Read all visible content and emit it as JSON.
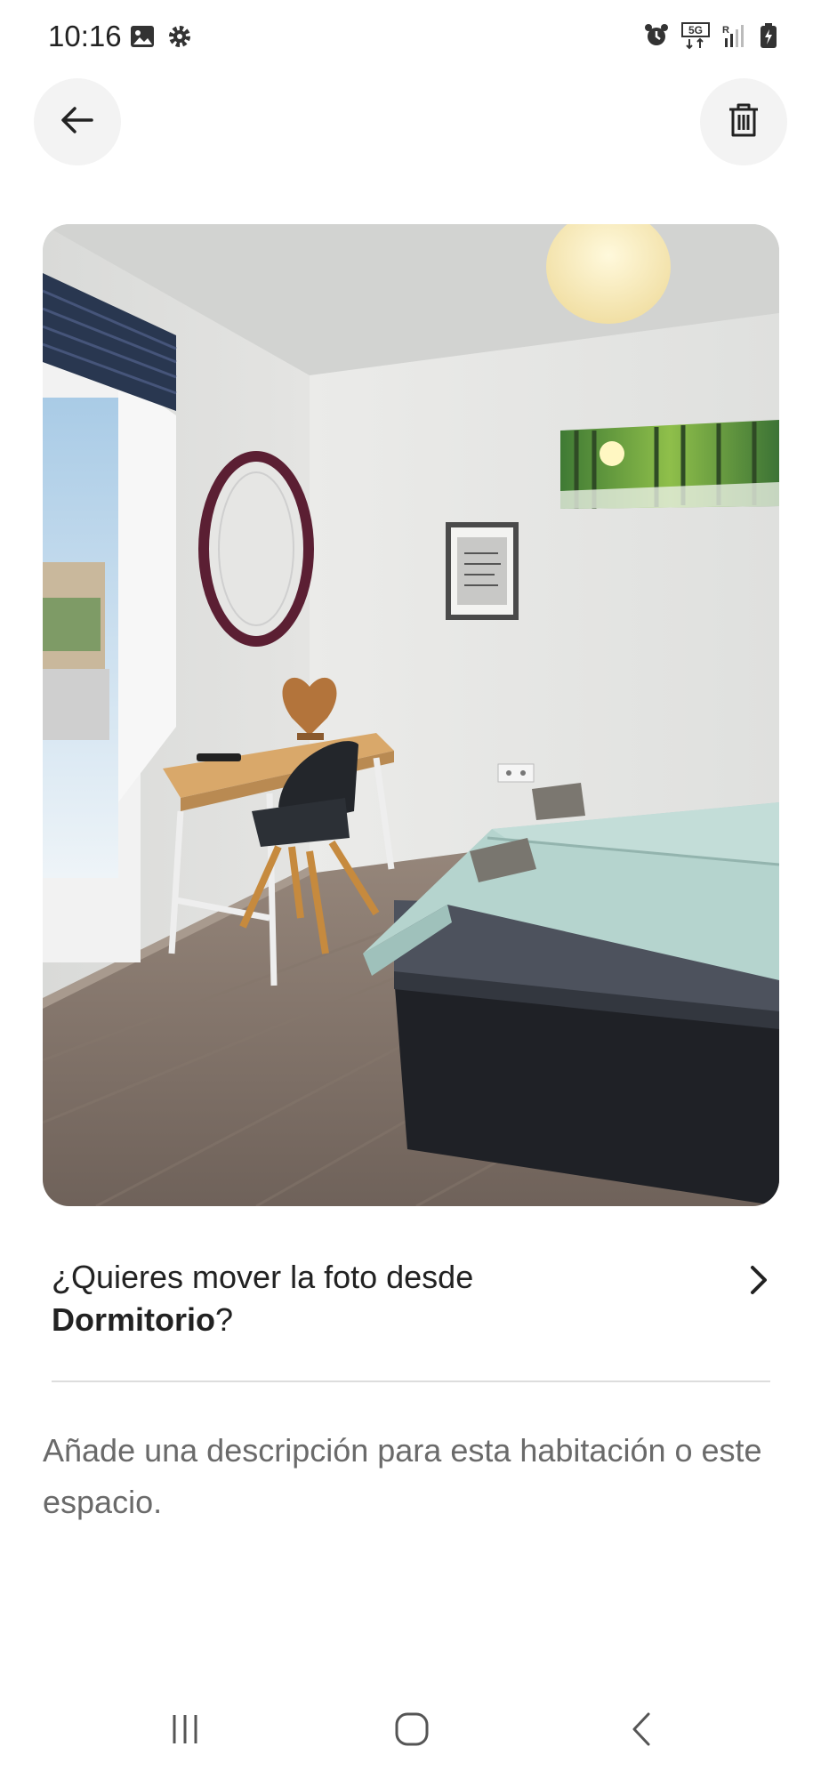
{
  "status_bar": {
    "time": "10:16",
    "left_icons": [
      "image-icon",
      "gear-icon"
    ],
    "right_icons": [
      "alarm-icon",
      "5g-icon",
      "signal-icon",
      "battery-icon"
    ]
  },
  "header": {
    "back_icon": "arrow-left-icon",
    "delete_icon": "trash-icon"
  },
  "photo": {
    "subject": "bedroom"
  },
  "move_prompt": {
    "prefix": "¿Quieres mover la foto desde",
    "room": "Dormitorio",
    "suffix": "?",
    "chevron_icon": "chevron-right-icon"
  },
  "description": {
    "placeholder": "Añade una descripción para esta habitación o este espacio."
  },
  "nav_bar": {
    "icons": [
      "recents-icon",
      "home-icon",
      "back-icon"
    ]
  }
}
